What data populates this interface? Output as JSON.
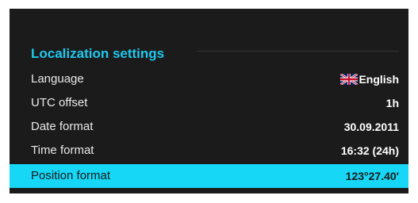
{
  "section": {
    "title": "Localization settings"
  },
  "settings": [
    {
      "label": "Language",
      "value": "English",
      "icon": "uk-flag-icon"
    },
    {
      "label": "UTC offset",
      "value": "1h"
    },
    {
      "label": "Date format",
      "value": "30.09.2011"
    },
    {
      "label": "Time format",
      "value": "16:32 (24h)"
    },
    {
      "label": "Position format",
      "value": "123°27.40'",
      "selected": true
    }
  ],
  "colors": {
    "panel_background": "#1b1b1b",
    "accent": "#1ec8ef",
    "selection": "#16d7f6",
    "text": "#e9e9e9"
  }
}
